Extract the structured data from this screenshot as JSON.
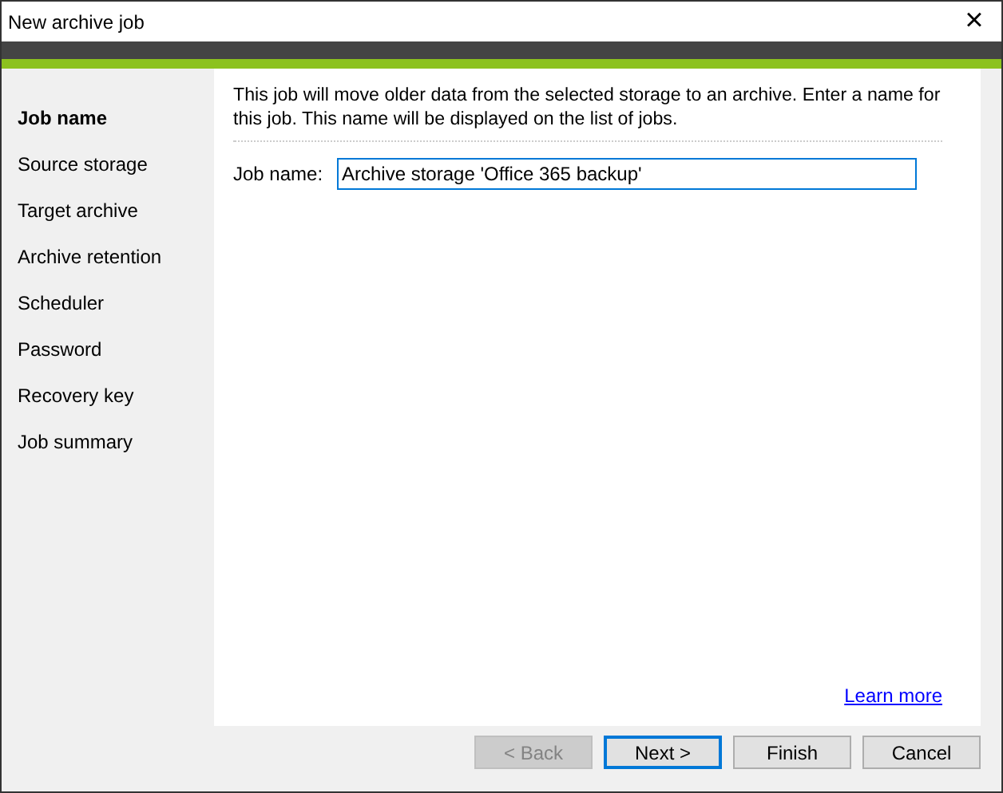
{
  "window": {
    "title": "New archive job",
    "close": "×"
  },
  "steps": [
    {
      "label": "Job name",
      "selected": true
    },
    {
      "label": "Source storage",
      "selected": false
    },
    {
      "label": "Target archive",
      "selected": false
    },
    {
      "label": "Archive retention",
      "selected": false
    },
    {
      "label": "Scheduler",
      "selected": false
    },
    {
      "label": "Password",
      "selected": false
    },
    {
      "label": "Recovery key",
      "selected": false
    },
    {
      "label": "Job summary",
      "selected": false
    }
  ],
  "description": "This job will move older data from the selected storage to an archive. Enter a name for this job. This name will be displayed on the list of jobs.",
  "job_name": {
    "label": "Job name:",
    "value": "Archive storage 'Office 365 backup'"
  },
  "learn_more": "Learn more",
  "buttons": [
    {
      "label": "< Back",
      "disabled": true,
      "focused": false
    },
    {
      "label": "Next >",
      "disabled": false,
      "focused": true
    },
    {
      "label": "Finish",
      "disabled": false,
      "focused": false
    },
    {
      "label": "Cancel",
      "disabled": false,
      "focused": false
    }
  ]
}
